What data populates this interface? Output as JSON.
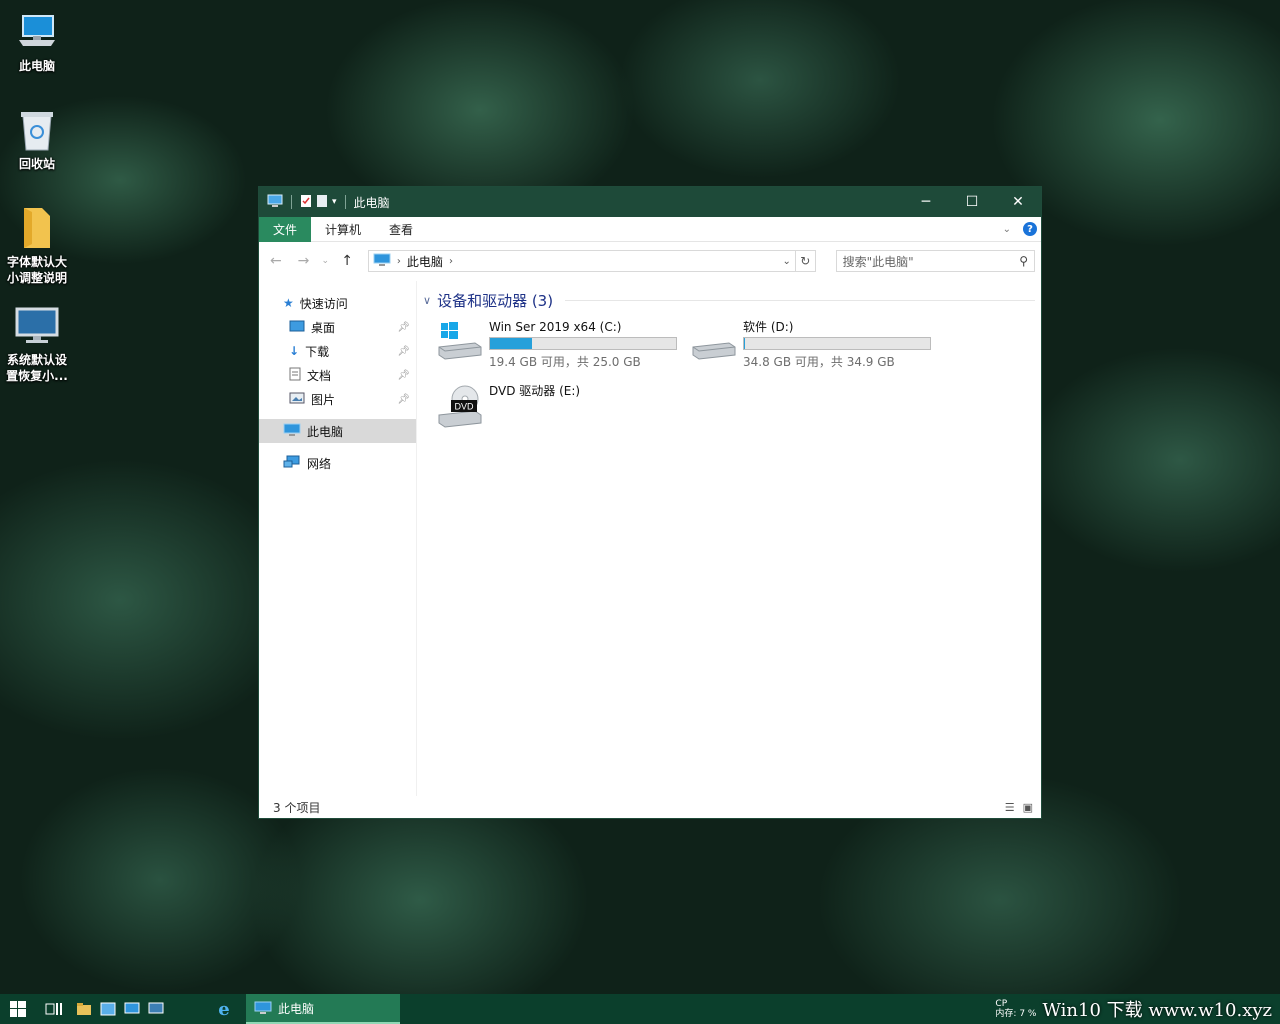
{
  "desktop": {
    "icons": [
      {
        "label": "此电脑"
      },
      {
        "label": "回收站"
      },
      {
        "label": "字体默认大小调整说明"
      },
      {
        "label": "系统默认设置恢复小..."
      }
    ]
  },
  "window": {
    "title": "此电脑",
    "ribbon_tabs": [
      "文件",
      "计算机",
      "查看"
    ],
    "address_crumb": "此电脑",
    "search_placeholder": "搜索\"此电脑\"",
    "nav": {
      "quick_access": "快速访问",
      "items": [
        "桌面",
        "下载",
        "文档",
        "图片"
      ],
      "this_pc": "此电脑",
      "network": "网络"
    },
    "group_header": "设备和驱动器 (3)",
    "drives": [
      {
        "name": "Win Ser 2019 x64 (C:)",
        "free_text": "19.4 GB 可用，共 25.0 GB",
        "used_fraction": 0.224
      },
      {
        "name": "软件 (D:)",
        "free_text": "34.8 GB 可用，共 34.9 GB",
        "used_fraction": 0.003
      },
      {
        "name": "DVD 驱动器 (E:)",
        "dvd_label": "DVD"
      }
    ],
    "status": "3 个项目"
  },
  "taskbar": {
    "active_window": "此电脑",
    "tray_cpu": "CP",
    "tray_mem_label": "内存:",
    "tray_mem_value": "7 %",
    "watermark": "Win10 下载 www.w10.xyz"
  },
  "colors": {
    "titlebar": "#1e4a39",
    "file_tab": "#2a8a5f",
    "taskbar": "#0b3f2c",
    "drive_bar": "#26a0da"
  }
}
